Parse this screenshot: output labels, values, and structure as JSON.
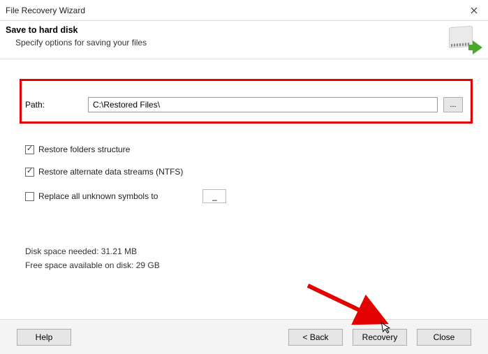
{
  "window": {
    "title": "File Recovery Wizard"
  },
  "header": {
    "title": "Save to hard disk",
    "subtitle": "Specify options for saving your files"
  },
  "path": {
    "label": "Path:",
    "value": "C:\\Restored Files\\",
    "browse_label": "..."
  },
  "options": {
    "restore_folders": {
      "label": "Restore folders structure",
      "checked": true
    },
    "restore_ads": {
      "label": "Restore alternate data streams (NTFS)",
      "checked": true
    },
    "replace_symbols": {
      "label": "Replace all unknown symbols to",
      "checked": false,
      "value": "_"
    }
  },
  "disk": {
    "needed": "Disk space needed: 31.21 MB",
    "free": "Free space available on disk: 29 GB"
  },
  "buttons": {
    "help": "Help",
    "back": "< Back",
    "recovery": "Recovery",
    "close": "Close"
  }
}
